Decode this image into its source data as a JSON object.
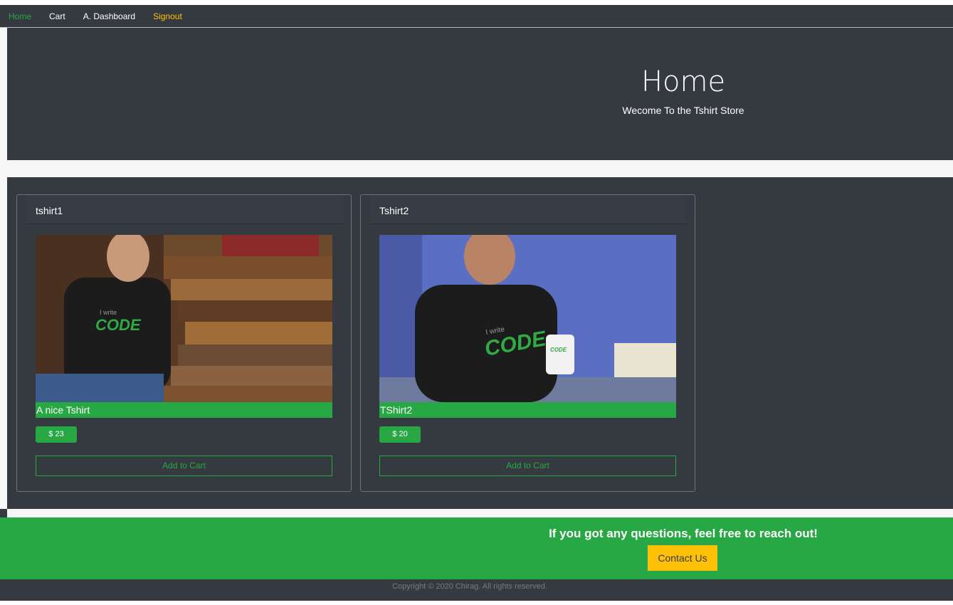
{
  "nav": {
    "items": [
      {
        "label": "Home",
        "state": "active"
      },
      {
        "label": "Cart",
        "state": "normal"
      },
      {
        "label": "A. Dashboard",
        "state": "normal"
      },
      {
        "label": "Signout",
        "state": "warning"
      }
    ]
  },
  "hero": {
    "title": "Home",
    "subtitle": "Wecome To the Tshirt Store"
  },
  "products": [
    {
      "header": "tshirt1",
      "title": "A nice Tshirt",
      "price": "$ 23",
      "button": "Add to Cart",
      "image_icon": "tshirt-photo-wood-background",
      "shirt_text_small": "I write",
      "shirt_text_big": "CODE"
    },
    {
      "header": "Tshirt2",
      "title": "TShirt2",
      "price": "$ 20",
      "button": "Add to Cart",
      "image_icon": "tshirt-photo-blue-background",
      "shirt_text_small": "I write",
      "shirt_text_big": "CODE",
      "mug_text": "CODE"
    }
  ],
  "footer": {
    "text": "If you got any questions, feel free to reach out!",
    "contact_button": "Contact Us",
    "copyright": "Copyright © 2020 Chirag. All rights reserved."
  },
  "colors": {
    "dark": "#343a40",
    "success": "#28a745",
    "warning": "#ffc107"
  }
}
